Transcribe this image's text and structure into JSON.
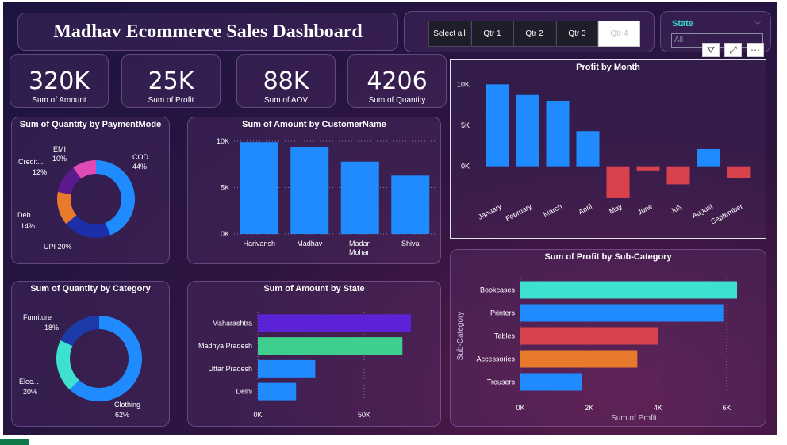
{
  "header": {
    "title": "Madhav Ecommerce Sales Dashboard"
  },
  "quarter_slicer": {
    "items": [
      "Select all",
      "Qtr 1",
      "Qtr 2",
      "Qtr 3",
      "Qtr 4"
    ],
    "selected": "Qtr 4"
  },
  "state_slicer": {
    "label": "State",
    "value": "All"
  },
  "visual_toolbar": {
    "icons": [
      "filter-icon",
      "focus-mode-icon",
      "more-options-icon"
    ]
  },
  "kpis": [
    {
      "value": "320K",
      "label": "Sum of Amount"
    },
    {
      "value": "25K",
      "label": "Sum of Profit"
    },
    {
      "value": "88K",
      "label": "Sum of AOV"
    },
    {
      "value": "4206",
      "label": "Sum of Quantity"
    }
  ],
  "charts": {
    "payment": {
      "title": "Sum of Quantity by PaymentMode"
    },
    "customer": {
      "title": "Sum of Amount by CustomerName"
    },
    "month": {
      "title": "Profit by Month"
    },
    "category": {
      "title": "Sum of Quantity by Category"
    },
    "state": {
      "title": "Sum of Amount by State"
    },
    "subcat": {
      "title": "Sum of Profit by Sub-Category"
    }
  },
  "chart_data": [
    {
      "id": "payment",
      "type": "pie",
      "slices": [
        {
          "label": "COD",
          "value": 44,
          "value_label": "44%",
          "color": "#1f8bff"
        },
        {
          "label": "UPI",
          "value": 20,
          "value_label": "UPI 20%",
          "color": "#1c2fa8"
        },
        {
          "label": "Deb...",
          "value": 14,
          "value_label": "14%",
          "color": "#e87a2e"
        },
        {
          "label": "Credit...",
          "value": 12,
          "value_label": "12%",
          "color": "#5b1a8c"
        },
        {
          "label": "EMI",
          "value": 10,
          "value_label": "10%",
          "color": "#e04ab4"
        }
      ]
    },
    {
      "id": "customer",
      "type": "bar",
      "categories": [
        "Harivansh",
        "Madhav",
        "Madan Mohan",
        "Shiva"
      ],
      "values": [
        9900,
        9400,
        7800,
        6300
      ],
      "ylim": [
        0,
        10000
      ],
      "yticks": [
        {
          "v": 0,
          "t": "0K"
        },
        {
          "v": 5000,
          "t": "5K"
        },
        {
          "v": 10000,
          "t": "10K"
        }
      ],
      "color": "#1f8bff"
    },
    {
      "id": "month",
      "type": "bar",
      "categories": [
        "January",
        "February",
        "March",
        "April",
        "May",
        "June",
        "July",
        "August",
        "September"
      ],
      "values": [
        10000,
        8700,
        8000,
        4300,
        -3800,
        -500,
        -2200,
        2100,
        -1400
      ],
      "ylim": [
        -4000,
        11000
      ],
      "yticks": [
        {
          "v": 0,
          "t": "0K"
        },
        {
          "v": 5000,
          "t": "5K"
        },
        {
          "v": 10000,
          "t": "10K"
        }
      ],
      "pos_color": "#1f8bff",
      "neg_color": "#d9414c"
    },
    {
      "id": "category",
      "type": "pie",
      "slices": [
        {
          "label": "Clothing",
          "value": 62,
          "value_label": "62%",
          "color": "#1f8bff"
        },
        {
          "label": "Elec...",
          "value": 20,
          "value_label": "20%",
          "color": "#3ee0d0"
        },
        {
          "label": "Furniture",
          "value": 18,
          "value_label": "18%",
          "color": "#1c3aa8"
        }
      ]
    },
    {
      "id": "state",
      "type": "bar",
      "orientation": "horizontal",
      "categories": [
        "Maharashtra",
        "Madhya Pradesh",
        "Uttar Pradesh",
        "Delhi"
      ],
      "values": [
        72000,
        68000,
        27000,
        18000
      ],
      "xlim": [
        0,
        72000
      ],
      "xticks": [
        {
          "v": 0,
          "t": "0K"
        },
        {
          "v": 50000,
          "t": "50K"
        }
      ],
      "colors": [
        "#5b22d6",
        "#3ecf8e",
        "#1f8bff",
        "#1f8bff"
      ]
    },
    {
      "id": "subcat",
      "type": "bar",
      "orientation": "horizontal",
      "categories": [
        "Bookcases",
        "Printers",
        "Tables",
        "Accessories",
        "Trousers"
      ],
      "values": [
        6300,
        5900,
        4000,
        3400,
        1800
      ],
      "xlim": [
        0,
        6600
      ],
      "xticks": [
        {
          "v": 0,
          "t": "0K"
        },
        {
          "v": 2000,
          "t": "2K"
        },
        {
          "v": 4000,
          "t": "4K"
        },
        {
          "v": 6000,
          "t": "6K"
        }
      ],
      "xlabel": "Sum of Profit",
      "ylabel": "Sub-Category",
      "colors": [
        "#3ee0d0",
        "#1f8bff",
        "#d9414c",
        "#e87a2e",
        "#1f8bff"
      ]
    }
  ]
}
